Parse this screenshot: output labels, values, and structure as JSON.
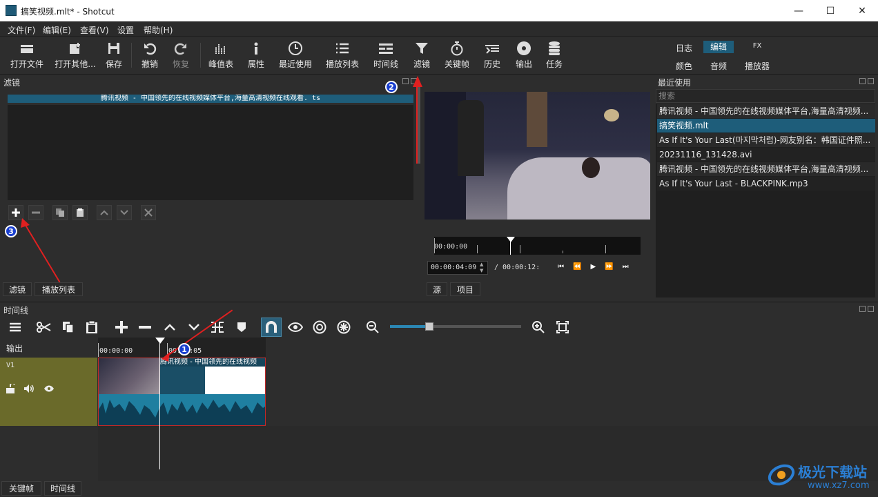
{
  "window": {
    "title": "搞笑视频.mlt* - Shotcut",
    "minimize": "—",
    "maximize": "☐",
    "close": "✕"
  },
  "menu": [
    "文件(F)",
    "编辑(E)",
    "查看(V)",
    "设置",
    "帮助(H)"
  ],
  "toolbar": {
    "open": "打开文件",
    "open_other": "打开其他...",
    "save": "保存",
    "undo": "撤销",
    "redo": "恢复",
    "peak": "峰值表",
    "props": "属性",
    "recent": "最近使用",
    "playlist": "播放列表",
    "timeline": "时间线",
    "filters": "滤镜",
    "keyframes": "关键帧",
    "history": "历史",
    "export": "输出",
    "jobs": "任务"
  },
  "workspaces": {
    "log": "日志",
    "edit": "编辑",
    "fx": "FX",
    "color": "颜色",
    "audio": "音频",
    "player": "播放器"
  },
  "filters_panel": {
    "title": "滤镜",
    "clip_name": "腾讯视频 - 中国领先的在线视频媒体平台,海量高清视频在线观看. ts",
    "tab_filters": "滤镜",
    "tab_playlist": "播放列表"
  },
  "player": {
    "ruler_start": "00:00:00",
    "position": "00:00:04:09",
    "duration": "/ 00:00:12:",
    "tab_source": "源",
    "tab_project": "项目"
  },
  "recent": {
    "title": "最近使用",
    "search_placeholder": "搜索",
    "items": [
      "腾讯视频 - 中国领先的在线视频媒体平台,海量高清视频...",
      "搞笑视频.mlt",
      "As If It's Your Last(마지막처럼)-网友别名：韩国证件照...",
      "20231116_131428.avi",
      "腾讯视频 - 中国领先的在线视频媒体平台,海量高清视频...",
      "As If It's Your Last - BLACKPINK.mp3"
    ],
    "selected_index": 1
  },
  "timeline": {
    "title": "时间线",
    "output_label": "输出",
    "track_name": "V1",
    "ruler_start": "00:00:00",
    "ruler_mark": "00:00:05",
    "clip2_title": "腾讯视频 - 中国领先的在线视频",
    "zoom_level": 0.3
  },
  "bottom_tabs": {
    "keyframes": "关键帧",
    "timeline": "时间线"
  },
  "annotations": {
    "one": "1",
    "two": "2",
    "three": "3"
  },
  "watermark": {
    "brand": "极光下载站",
    "url": "www.xz7.com"
  },
  "colors": {
    "accent": "#1e5d7a",
    "track": "#6a6a2a",
    "annotation_red": "#e02020",
    "annotation_blue": "#1a3fcf"
  }
}
